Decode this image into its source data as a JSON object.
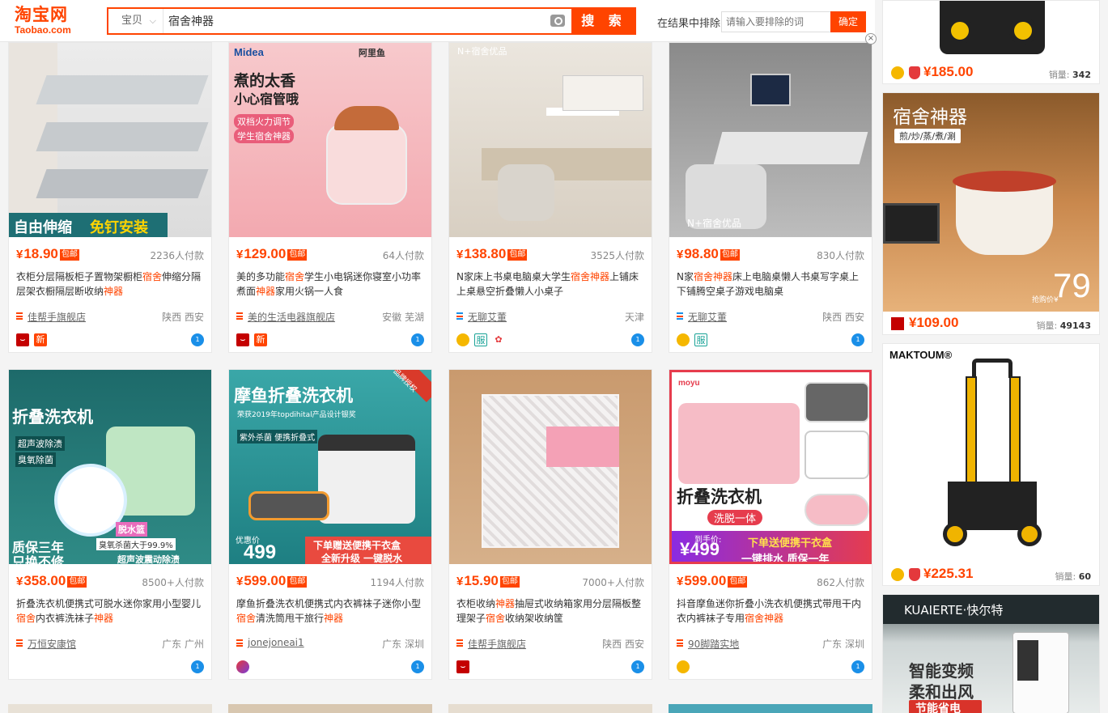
{
  "header": {
    "logo_cn": "淘宝网",
    "logo_en": "Taobao.com",
    "search_category": "宝贝",
    "search_query": "宿舍神器",
    "search_button": "搜 索",
    "exclude_label": "在结果中排除",
    "exclude_placeholder": "请输入要排除的词",
    "exclude_button": "确定"
  },
  "products": [
    {
      "price": "18.90",
      "tag": "包邮",
      "sales": "2236人付款",
      "title_parts": [
        "衣柜分层隔板柜子置物架橱柜",
        "宿舍",
        "伸缩分隔层架衣橱隔层断收纳",
        "神器"
      ],
      "shop": "佳帮手旗舰店",
      "location": "陕西 西安",
      "img_text1": "自由伸缩",
      "img_text2": "免钉安装"
    },
    {
      "price": "129.00",
      "tag": "包邮",
      "sales": "64人付款",
      "title_parts": [
        "美的多功能",
        "宿舍",
        "学生小电锅迷你寝室小功率煮面",
        "神器",
        "家用火锅一人食"
      ],
      "shop": "美的生活电器旗舰店",
      "location": "安徽 芜湖",
      "img_text1": "煮的太香",
      "img_text2": "小心宿管哦",
      "img_text3": "双档火力调节",
      "img_text4": "学生宿舍神器",
      "img_brand": "Midea",
      "img_brand2": "阿里鱼"
    },
    {
      "price": "138.80",
      "tag": "包邮",
      "sales": "3525人付款",
      "title_parts": [
        "N家床上书桌电脑桌大学生",
        "宿舍神器",
        "上铺床上桌悬空折叠懒人小桌子"
      ],
      "shop": "无聊艾董",
      "location": "天津",
      "img_text1": "N+宿舍优品"
    },
    {
      "price": "98.80",
      "tag": "包邮",
      "sales": "830人付款",
      "title_parts": [
        "N家",
        "宿舍神器",
        "床上电脑桌懒人书桌写字桌上下铺腾空桌子游戏电脑桌"
      ],
      "shop": "无聊艾董",
      "location": "陕西 西安",
      "img_text1": "N+宿舍优品"
    },
    {
      "price": "358.00",
      "tag": "包邮",
      "sales": "8500+人付款",
      "title_parts": [
        "折叠洗衣机便携式可脱水迷你家用小型婴儿",
        "宿舍",
        "内衣裤洗袜子",
        "神器"
      ],
      "shop": "万恒安康馆",
      "location": "广东 广州",
      "img_text1": "折叠洗衣机",
      "img_text2": "超声波除渍",
      "img_text3": "臭氧除菌",
      "img_text4": "质保三年",
      "img_text5": "只换不修",
      "img_text6": "脱水篮",
      "img_text7": "臭氧杀菌大于99.9%",
      "img_text8": "超声波震动除渍"
    },
    {
      "price": "599.00",
      "tag": "包邮",
      "sales": "1194人付款",
      "title_parts": [
        "摩鱼折叠洗衣机便携式内衣裤袜子迷你小型",
        "宿舍",
        "清洗筒甩干旅行",
        "神器"
      ],
      "shop": "jonejoneai1",
      "location": "广东 深圳",
      "img_text1": "摩鱼折叠洗衣机",
      "img_text2": "荣获2019年topdihital产品设计银奖",
      "img_text3": "紫外杀菌 便携折叠式",
      "img_text4": "优惠价",
      "img_text5": "499",
      "img_text6": "下单赠送便携干衣盒",
      "img_text7": "全新升级 一键脱水",
      "img_text8": "品牌授权"
    },
    {
      "price": "15.90",
      "tag": "包邮",
      "sales": "7000+人付款",
      "title_parts": [
        "衣柜收纳",
        "神器",
        "抽屉式收纳箱家用分层隔板整理架子",
        "宿舍",
        "收纳架收纳筐"
      ],
      "shop": "佳帮手旗舰店",
      "location": "陕西 西安"
    },
    {
      "price": "599.00",
      "tag": "包邮",
      "sales": "862人付款",
      "title_parts": [
        "抖音摩鱼迷你折叠小洗衣机便携式带甩干内衣内裤袜子专用",
        "宿舍神器"
      ],
      "shop": "90脚踏实地",
      "location": "广东 深圳",
      "img_text1": "折叠洗衣机",
      "img_text2": "洗脱一体",
      "img_text3": "到手价:",
      "img_text4": "¥499",
      "img_text5": "下单送便携干衣盒",
      "img_text6": "一键排水 质保一年",
      "img_brand": "moyu"
    }
  ],
  "ads": [
    {
      "price": "185.00",
      "sales_label": "销量:",
      "sales": "342"
    },
    {
      "price": "109.00",
      "sales_label": "销量:",
      "sales": "49143",
      "img_title": "宿舍神器",
      "img_sub": "煎/炒/蒸/煮/涮",
      "img_price_label": "抢购价¥",
      "img_price": "79"
    },
    {
      "price": "225.31",
      "sales_label": "销量:",
      "sales": "60",
      "img_brand": "MAKTOUM®"
    },
    {
      "img_brand": "KUAIERTE·快尔特",
      "img_text1": "智能变频",
      "img_text2": "柔和出风",
      "img_text3": "节能省电"
    }
  ],
  "currency": "¥",
  "colors": {
    "accent": "#ff4400",
    "link_blue": "#1a8fe8"
  }
}
